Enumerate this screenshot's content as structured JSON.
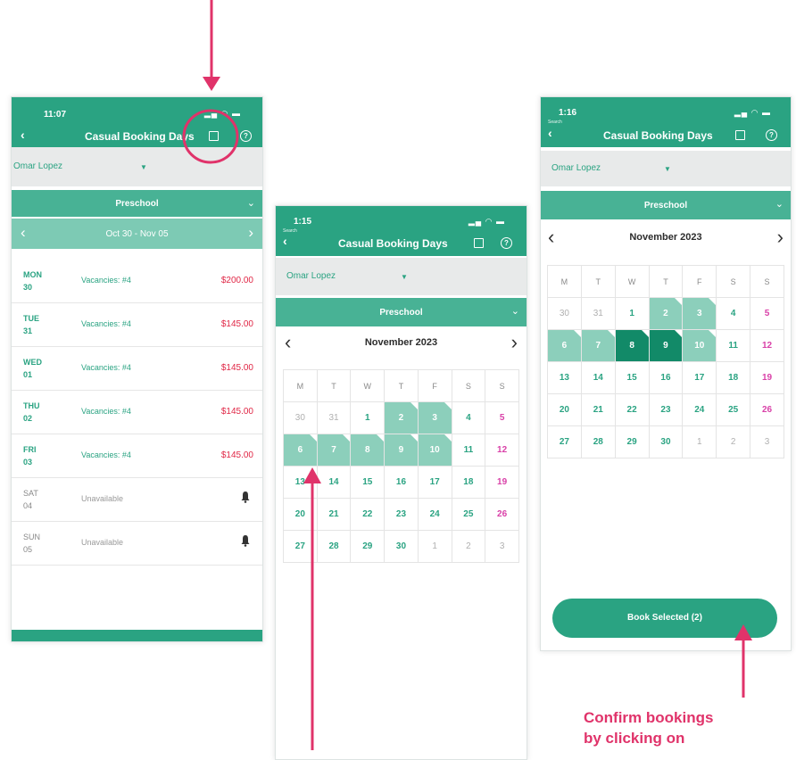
{
  "phones": {
    "left": {
      "status_time": "11:07",
      "title": "Casual Booking Days",
      "child": "Omar Lopez",
      "section": "Preschool",
      "week_range": "Oct 30 - Nov 05",
      "rows": [
        {
          "dow": "MON",
          "date": "30",
          "status": "Vacancies: #4",
          "price": "$200.00",
          "available": true
        },
        {
          "dow": "TUE",
          "date": "31",
          "status": "Vacancies: #4",
          "price": "$145.00",
          "available": true
        },
        {
          "dow": "WED",
          "date": "01",
          "status": "Vacancies: #4",
          "price": "$145.00",
          "available": true
        },
        {
          "dow": "THU",
          "date": "02",
          "status": "Vacancies: #4",
          "price": "$145.00",
          "available": true
        },
        {
          "dow": "FRI",
          "date": "03",
          "status": "Vacancies: #4",
          "price": "$145.00",
          "available": true
        },
        {
          "dow": "SAT",
          "date": "04",
          "status": "Unavailable",
          "price": "",
          "available": false
        },
        {
          "dow": "SUN",
          "date": "05",
          "status": "Unavailable",
          "price": "",
          "available": false
        }
      ]
    },
    "middle": {
      "search_label": "Search",
      "status_time": "1:15",
      "title": "Casual Booking Days",
      "child": "Omar Lopez",
      "section": "Preschool",
      "month": "November 2023"
    },
    "right": {
      "search_label": "Search",
      "status_time": "1:16",
      "title": "Casual Booking Days",
      "child": "Omar Lopez",
      "section": "Preschool",
      "month": "November 2023",
      "book_button": "Book Selected (2)"
    }
  },
  "calendar": {
    "weekdays": [
      "M",
      "T",
      "W",
      "T",
      "F",
      "S",
      "S"
    ],
    "weeks": [
      [
        "30",
        "31",
        "1",
        "2",
        "3",
        "4",
        "5"
      ],
      [
        "6",
        "7",
        "8",
        "9",
        "10",
        "11",
        "12"
      ],
      [
        "13",
        "14",
        "15",
        "16",
        "17",
        "18",
        "19"
      ],
      [
        "20",
        "21",
        "22",
        "23",
        "24",
        "25",
        "26"
      ],
      [
        "27",
        "28",
        "29",
        "30",
        "1",
        "2",
        "3"
      ]
    ]
  },
  "annotation": {
    "line1": "Confirm bookings",
    "line2": "by clicking on"
  },
  "colors": {
    "brand": "#2aa382",
    "price_red": "#e02645",
    "annotation_pink": "#e0336a",
    "selected_light": "#8ccfbb",
    "selected_dark": "#128a68"
  }
}
